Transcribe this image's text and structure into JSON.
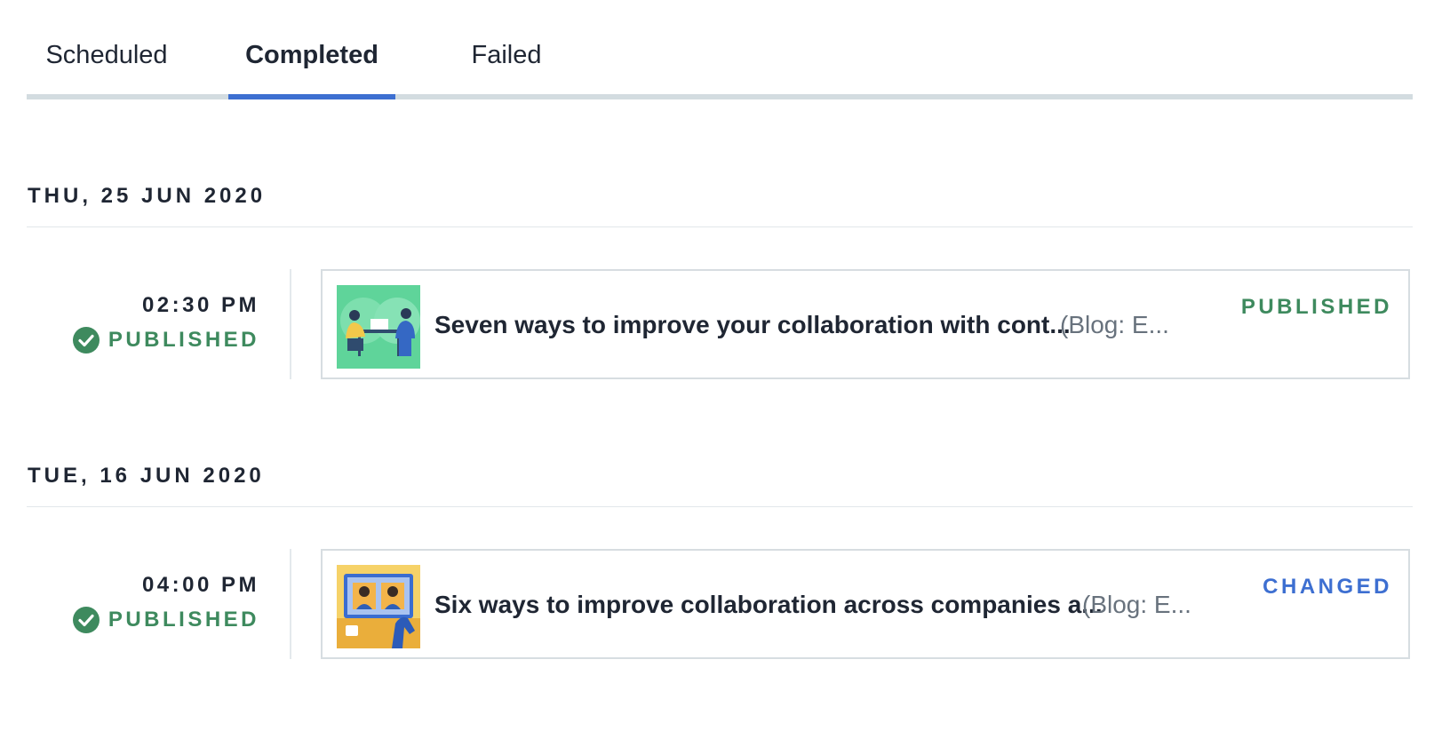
{
  "tabs": [
    {
      "label": "Scheduled",
      "active": false
    },
    {
      "label": "Completed",
      "active": true
    },
    {
      "label": "Failed",
      "active": false
    }
  ],
  "colors": {
    "accent": "#3d6fd1",
    "published": "#3e8a5e",
    "changed": "#3d6fd1",
    "tab_track": "#d3dce0"
  },
  "groups": [
    {
      "date": "THU, 25 JUN 2020",
      "events": [
        {
          "time": "02:30 PM",
          "status_label": "PUBLISHED",
          "status_icon": "check-circle-icon",
          "entry": {
            "title": "Seven ways to improve your collaboration with cont...",
            "meta": "(Blog: E...",
            "state": "PUBLISHED",
            "thumbnail": "illustration-two-people-at-table"
          }
        }
      ]
    },
    {
      "date": "TUE, 16 JUN 2020",
      "events": [
        {
          "time": "04:00 PM",
          "status_label": "PUBLISHED",
          "status_icon": "check-circle-icon",
          "entry": {
            "title": "Six ways to improve collaboration across companies a...",
            "meta": "(Blog: E...",
            "state": "CHANGED",
            "thumbnail": "illustration-video-call-screen"
          }
        }
      ]
    }
  ]
}
